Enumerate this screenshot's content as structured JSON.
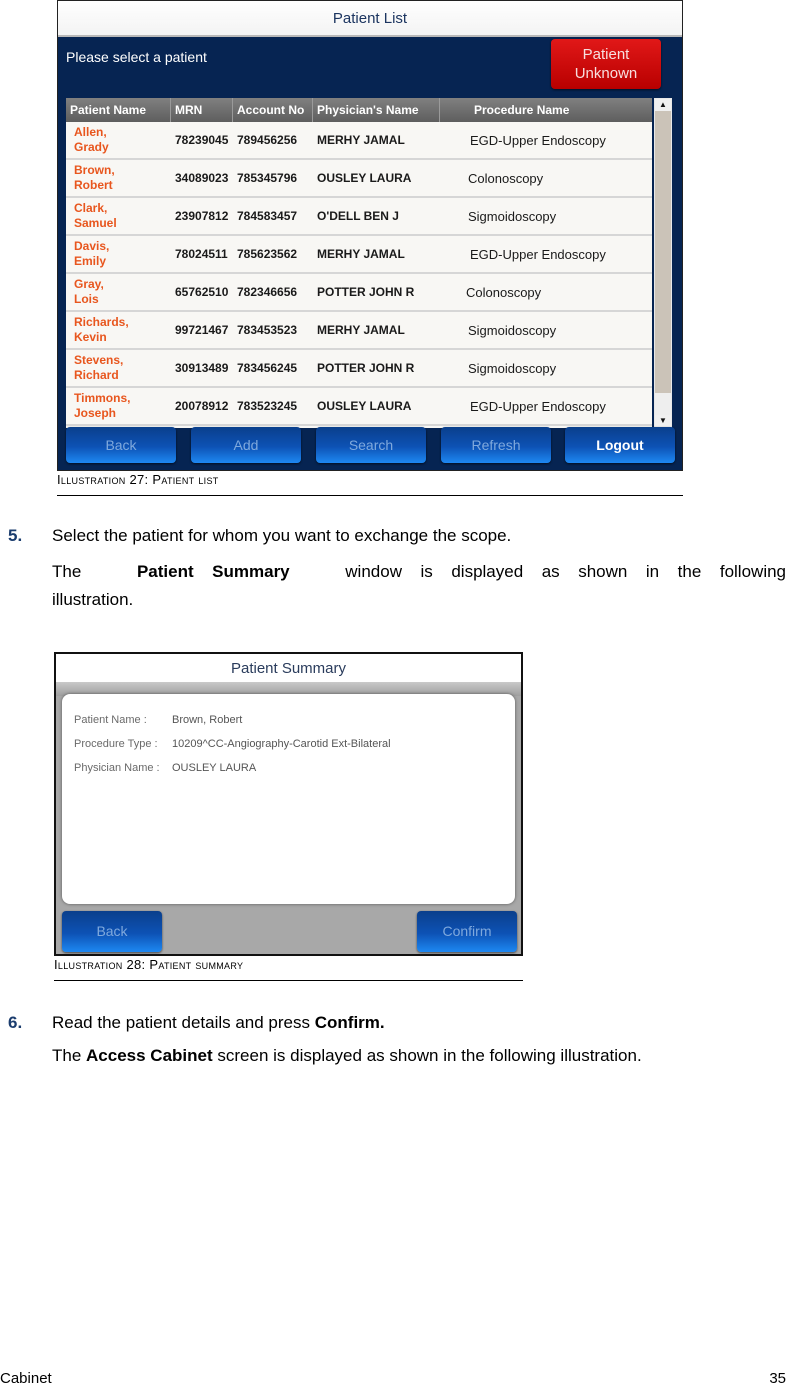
{
  "illustration_27": {
    "window_title": "Patient List",
    "prompt": "Please select a patient",
    "patient_unknown_button": "Patient Unknown",
    "columns": [
      "Patient Name",
      "MRN",
      "Account No",
      "Physician's Name",
      "Procedure Name"
    ],
    "rows": [
      {
        "last": "Allen,",
        "first": "Grady",
        "mrn": "78239045",
        "account": "789456256",
        "physician": "MERHY JAMAL",
        "procedure": "EGD-Upper Endoscopy"
      },
      {
        "last": "Brown,",
        "first": "Robert",
        "mrn": "34089023",
        "account": "785345796",
        "physician": "OUSLEY LAURA",
        "procedure": "Colonoscopy"
      },
      {
        "last": "Clark,",
        "first": "Samuel",
        "mrn": "23907812",
        "account": "784583457",
        "physician": "O'DELL BEN J",
        "procedure": "Sigmoidoscopy"
      },
      {
        "last": "Davis,",
        "first": "Emily",
        "mrn": "78024511",
        "account": "785623562",
        "physician": "MERHY JAMAL",
        "procedure": "EGD-Upper Endoscopy"
      },
      {
        "last": "Gray,",
        "first": "Lois",
        "mrn": "65762510",
        "account": "782346656",
        "physician": "POTTER JOHN R",
        "procedure": "Colonoscopy"
      },
      {
        "last": "Richards,",
        "first": "Kevin",
        "mrn": "99721467",
        "account": "783453523",
        "physician": "MERHY JAMAL",
        "procedure": "Sigmoidoscopy"
      },
      {
        "last": "Stevens,",
        "first": "Richard",
        "mrn": "30913489",
        "account": "783456245",
        "physician": "POTTER JOHN R",
        "procedure": "Sigmoidoscopy"
      },
      {
        "last": "Timmons,",
        "first": "Joseph",
        "mrn": "20078912",
        "account": "783523245",
        "physician": "OUSLEY LAURA",
        "procedure": "EGD-Upper Endoscopy"
      }
    ],
    "buttons": {
      "back": "Back",
      "add": "Add",
      "search": "Search",
      "refresh": "Refresh",
      "logout": "Logout"
    },
    "scroll_up_glyph": "▲",
    "scroll_down_glyph": "▼",
    "caption": "Illustration 27: Patient list"
  },
  "step5": {
    "number": "5.",
    "text": "Select the patient for whom you want to exchange the scope.",
    "result_prefix": "The",
    "result_bold": "Patient Summary",
    "result_suffix_line1": "window is displayed as shown in the following",
    "result_suffix_line2": "illustration."
  },
  "illustration_28": {
    "window_title": "Patient Summary",
    "fields": [
      {
        "label": "Patient Name :",
        "value": "Brown, Robert"
      },
      {
        "label": "Procedure Type :",
        "value": "10209^CC-Angiography-Carotid Ext-Bilateral"
      },
      {
        "label": "Physician Name :",
        "value": "OUSLEY LAURA"
      }
    ],
    "buttons": {
      "back": "Back",
      "confirm": "Confirm"
    },
    "caption": "Illustration 28: Patient summary"
  },
  "step6": {
    "number": "6.",
    "text_prefix": "Read the patient details and press",
    "text_bold": "Confirm.",
    "result_prefix": "The",
    "result_bold": "Access Cabinet",
    "result_suffix": "screen is displayed as shown in the following illustration."
  },
  "footer": {
    "section": "Cabinet",
    "page": "35"
  }
}
